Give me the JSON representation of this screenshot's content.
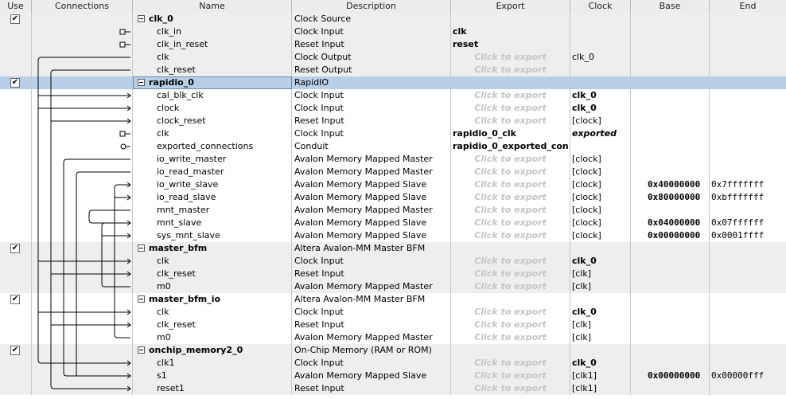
{
  "columns": {
    "use": "Use",
    "connections": "Connections",
    "name": "Name",
    "description": "Description",
    "export": "Export",
    "clock": "Clock",
    "base": "Base",
    "end": "End"
  },
  "selected_row_index": 5,
  "selection_color": "#b8cfe8",
  "rows": [
    {
      "component": true,
      "checked": true,
      "name": "clk_0",
      "description": "Clock Source"
    },
    {
      "name": "clk_in",
      "description": "Clock Input",
      "export": "clk",
      "export_style": "val"
    },
    {
      "name": "clk_in_reset",
      "description": "Reset Input",
      "export": "reset",
      "export_style": "val"
    },
    {
      "name": "clk",
      "description": "Clock Output",
      "export": "Click to export",
      "export_style": "hint",
      "clock": "clk_0",
      "clock_style": "plain"
    },
    {
      "name": "clk_reset",
      "description": "Reset Output",
      "export": "Click to export",
      "export_style": "hint"
    },
    {
      "component": true,
      "checked": true,
      "name": "rapidio_0",
      "description": "RapidIO"
    },
    {
      "name": "cal_blk_clk",
      "description": "Clock Input",
      "export": "Click to export",
      "export_style": "hint",
      "clock": "clk_0",
      "clock_style": "bold"
    },
    {
      "name": "clock",
      "description": "Clock Input",
      "export": "Click to export",
      "export_style": "hint",
      "clock": "clk_0",
      "clock_style": "bold"
    },
    {
      "name": "clock_reset",
      "description": "Reset Input",
      "export": "Click to export",
      "export_style": "hint",
      "clock": "[clock]",
      "clock_style": "plain"
    },
    {
      "name": "clk",
      "description": "Clock Input",
      "export": "rapidio_0_clk",
      "export_style": "val",
      "clock": "exported",
      "clock_style": "ital"
    },
    {
      "name": "exported_connections",
      "description": "Conduit",
      "export": "rapidio_0_exported_con...",
      "export_style": "val"
    },
    {
      "name": "io_write_master",
      "description": "Avalon Memory Mapped Master",
      "export": "Click to export",
      "export_style": "hint",
      "clock": "[clock]",
      "clock_style": "plain"
    },
    {
      "name": "io_read_master",
      "description": "Avalon Memory Mapped Master",
      "export": "Click to export",
      "export_style": "hint",
      "clock": "[clock]",
      "clock_style": "plain"
    },
    {
      "name": "io_write_slave",
      "description": "Avalon Memory Mapped Slave",
      "export": "Click to export",
      "export_style": "hint",
      "clock": "[clock]",
      "clock_style": "plain",
      "base": "0x40000000",
      "end": "0x7fffffff"
    },
    {
      "name": "io_read_slave",
      "description": "Avalon Memory Mapped Slave",
      "export": "Click to export",
      "export_style": "hint",
      "clock": "[clock]",
      "clock_style": "plain",
      "base": "0x80000000",
      "end": "0xbfffffff"
    },
    {
      "name": "mnt_master",
      "description": "Avalon Memory Mapped Master",
      "export": "Click to export",
      "export_style": "hint",
      "clock": "[clock]",
      "clock_style": "plain"
    },
    {
      "name": "mnt_slave",
      "description": "Avalon Memory Mapped Slave",
      "export": "Click to export",
      "export_style": "hint",
      "clock": "[clock]",
      "clock_style": "plain",
      "base": "0x04000000",
      "end": "0x07ffffff"
    },
    {
      "name": "sys_mnt_slave",
      "description": "Avalon Memory Mapped Slave",
      "export": "Click to export",
      "export_style": "hint",
      "clock": "[clock]",
      "clock_style": "plain",
      "base": "0x00000000",
      "end": "0x0001ffff"
    },
    {
      "component": true,
      "checked": true,
      "name": "master_bfm",
      "description": "Altera Avalon-MM Master BFM"
    },
    {
      "name": "clk",
      "description": "Clock Input",
      "export": "Click to export",
      "export_style": "hint",
      "clock": "clk_0",
      "clock_style": "bold"
    },
    {
      "name": "clk_reset",
      "description": "Reset Input",
      "export": "Click to export",
      "export_style": "hint",
      "clock": "[clk]",
      "clock_style": "plain"
    },
    {
      "name": "m0",
      "description": "Avalon Memory Mapped Master",
      "export": "Click to export",
      "export_style": "hint",
      "clock": "[clk]",
      "clock_style": "plain"
    },
    {
      "component": true,
      "checked": true,
      "name": "master_bfm_io",
      "description": "Altera Avalon-MM Master BFM"
    },
    {
      "name": "clk",
      "description": "Clock Input",
      "export": "Click to export",
      "export_style": "hint",
      "clock": "clk_0",
      "clock_style": "bold"
    },
    {
      "name": "clk_reset",
      "description": "Reset Input",
      "export": "Click to export",
      "export_style": "hint",
      "clock": "[clk]",
      "clock_style": "plain"
    },
    {
      "name": "m0",
      "description": "Avalon Memory Mapped Master",
      "export": "Click to export",
      "export_style": "hint",
      "clock": "[clk]",
      "clock_style": "plain"
    },
    {
      "component": true,
      "checked": true,
      "name": "onchip_memory2_0",
      "description": "On-Chip Memory (RAM or ROM)"
    },
    {
      "name": "clk1",
      "description": "Clock Input",
      "export": "Click to export",
      "export_style": "hint",
      "clock": "clk_0",
      "clock_style": "bold"
    },
    {
      "name": "s1",
      "description": "Avalon Memory Mapped Slave",
      "export": "Click to export",
      "export_style": "hint",
      "clock": "[clk1]",
      "clock_style": "plain",
      "base": "0x00000000",
      "end": "0x00000fff"
    },
    {
      "name": "reset1",
      "description": "Reset Input",
      "export": "Click to export",
      "export_style": "hint",
      "clock": "[clk1]",
      "clock_style": "plain"
    }
  ]
}
